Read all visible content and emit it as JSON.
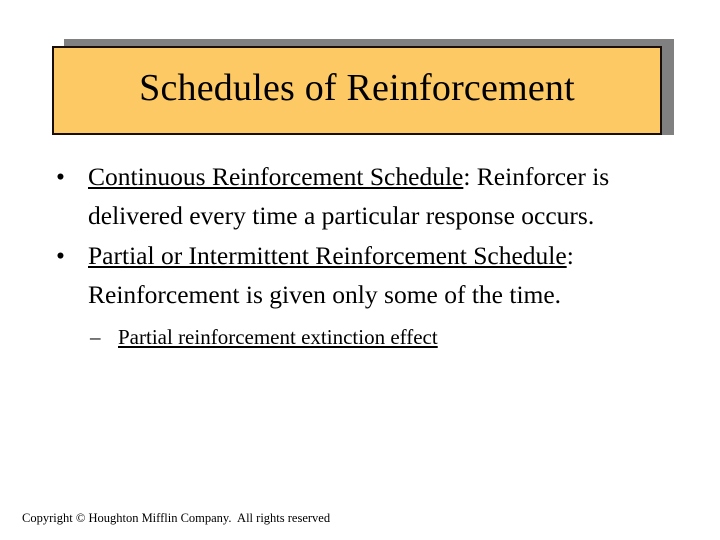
{
  "slide": {
    "title": "Schedules of Reinforcement",
    "title_box_fill": "#fcc964",
    "title_box_border": "#1a0d05",
    "title_box_shadow": "#808080",
    "background": "#ffffff",
    "text_color": "#000000"
  },
  "bullets": [
    {
      "marker": "•",
      "underlined_lead": "Continuous Reinforcement Schedule",
      "rest": ": Reinforcer is delivered every time a particular response occurs."
    },
    {
      "marker": "•",
      "underlined_lead": "Partial or Intermittent Reinforcement Schedule",
      "rest": ": Reinforcement is given only some of the time."
    }
  ],
  "sub_bullets": [
    {
      "marker": "–",
      "underlined_text": "Partial reinforcement extinction effect"
    }
  ],
  "footer": {
    "text": "Copyright © Houghton Mifflin Company.  All rights reserved"
  }
}
